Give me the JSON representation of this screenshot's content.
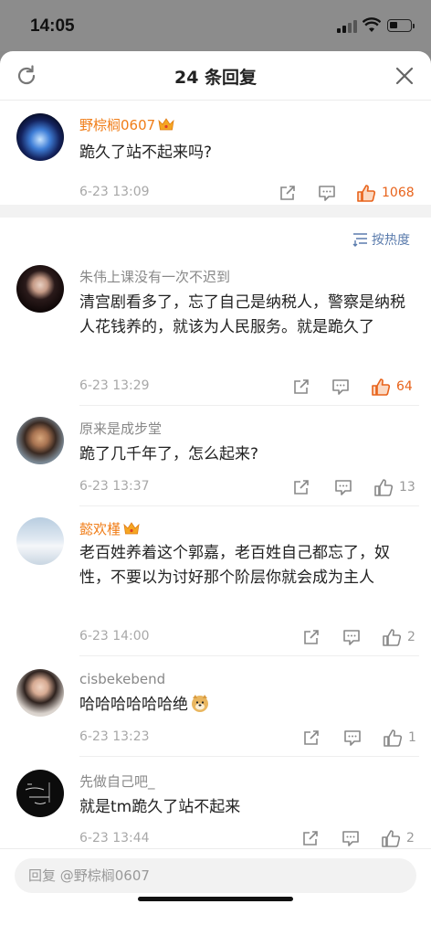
{
  "status_bar": {
    "time": "14:05"
  },
  "header": {
    "title": "24 条回复"
  },
  "sort_label": "按热度",
  "main_comment": {
    "user": "野棕榈0607",
    "text": "跪久了站不起来吗?",
    "time": "6-23 13:09",
    "likes": "1068",
    "liked": true
  },
  "replies": [
    {
      "user": "朱伟上课没有一次不迟到",
      "text": "清宫剧看多了，忘了自己是纳税人，警察是纳税人花钱养的，就该为人民服务。就是跪久了",
      "time": "6-23 13:29",
      "likes": "64",
      "liked": true
    },
    {
      "user": "原来是成步堂",
      "text": "跪了几千年了，怎么起来?",
      "time": "6-23 13:37",
      "likes": "13",
      "liked": false
    },
    {
      "user": "懿欢槿",
      "text": "老百姓养着这个郭嘉，老百姓自己都忘了，奴性，不要以为讨好那个阶层你就会成为主人",
      "time": "6-23 14:00",
      "likes": "2",
      "liked": false
    },
    {
      "user": "cisbekebend",
      "text": "哈哈哈哈哈哈绝",
      "time": "6-23 13:23",
      "likes": "1",
      "liked": false
    },
    {
      "user": "先做自己吧_",
      "text": "就是tm跪久了站不起来",
      "time": "6-23 13:44",
      "likes": "2",
      "liked": false
    }
  ],
  "reply_input": {
    "placeholder": "回复 @野棕榈0607"
  },
  "colors": {
    "accent_orange": "#e8631b",
    "vip_name": "#f07d18",
    "link_blue": "#5b7cad"
  }
}
